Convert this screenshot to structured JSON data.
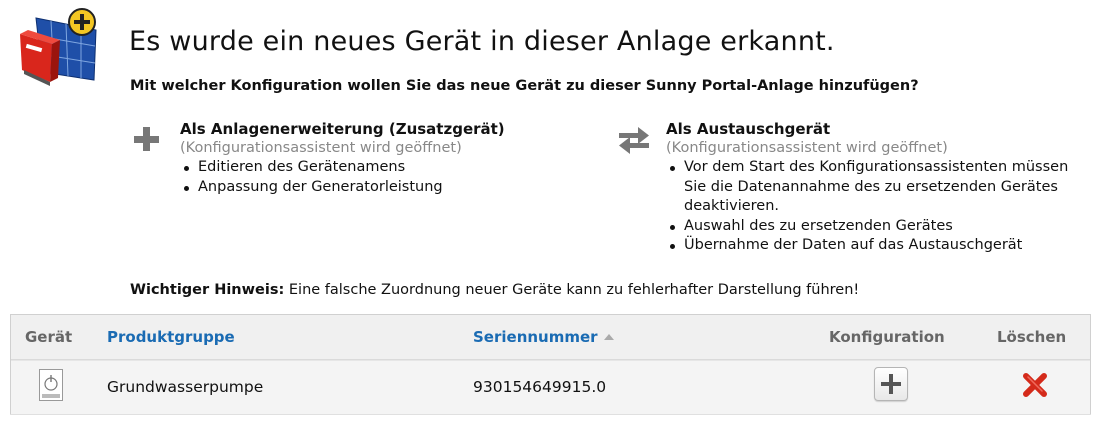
{
  "header": {
    "title": "Es wurde ein neues Gerät in dieser Anlage erkannt.",
    "question": "Mit welcher Konfiguration wollen Sie das neue Gerät zu dieser Sunny Portal-Anlage hinzufügen?",
    "icon": "inverter-with-plus-icon"
  },
  "options": {
    "extension": {
      "icon": "plus-icon",
      "title": "Als Anlagenerweiterung (Zusatzgerät)",
      "subtitle": "(Konfigurationsassistent wird geöffnet)",
      "items": [
        "Editieren des Gerätenamens",
        "Anpassung der Generatorleistung"
      ]
    },
    "replacement": {
      "icon": "swap-arrows-icon",
      "title": "Als Austauschgerät",
      "subtitle": "(Konfigurationsassistent wird geöffnet)",
      "items": [
        "Vor dem Start des Konfigurationsassistenten müssen Sie die Datenannahme des zu ersetzenden Gerätes deaktivieren.",
        "Auswahl des zu ersetzenden Gerätes",
        "Übernahme der Daten auf das Austauschgerät"
      ]
    }
  },
  "notice": {
    "label": "Wichtiger Hinweis:",
    "text": " Eine falsche Zuordnung neuer Geräte kann zu fehlerhafter Darstellung führen!"
  },
  "table": {
    "columns": {
      "device": "Gerät",
      "product_group": "Produktgruppe",
      "serial": "Seriennummer",
      "configuration": "Konfiguration",
      "delete": "Löschen"
    },
    "sort": {
      "column": "serial",
      "direction": "ascending"
    },
    "rows": [
      {
        "device_icon": "power-switch-icon",
        "product_group": "Grundwasserpumpe",
        "serial": "930154649915.0"
      }
    ]
  },
  "colors": {
    "link": "#1a6bb3",
    "muted": "#888888",
    "delete": "#d42a1a",
    "accent_yellow": "#f3c623"
  }
}
